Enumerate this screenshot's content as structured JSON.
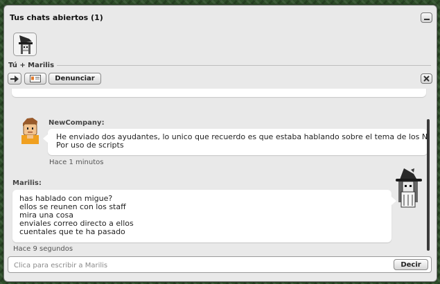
{
  "window": {
    "title": "Tus chats abiertos (1)"
  },
  "conversation": {
    "participants": "Tú + Marilis"
  },
  "toolbar": {
    "report_label": "Denunciar"
  },
  "messages": [
    {
      "sender": "NewCompany:",
      "lines": [
        "He enviado dos ayudantes, lo unico que recuerdo es que estaba hablando sobre el tema de los NTFs",
        "Por uso de scripts"
      ],
      "time": "Hace 1 minutos"
    },
    {
      "sender": "Marilis:",
      "lines": [
        "has hablado con migue?",
        "ellos se reunen con los staff",
        "mira una cosa",
        "enviales correo directo a ellos",
        "cuentales que te ha pasado"
      ],
      "time": "Hace 9 segundos"
    }
  ],
  "input": {
    "placeholder": "Clica para escribir a Marilis",
    "value": ""
  },
  "send": {
    "label": "Decir"
  },
  "icons": {
    "minimize": "minimize-icon",
    "close": "close-icon",
    "arrow": "arrow-right-icon",
    "profile": "profile-card-icon"
  },
  "colors": {
    "window_bg": "#e9e9e9",
    "bubble_bg": "#ffffff",
    "scroll_thumb": "#3a3a3a"
  }
}
